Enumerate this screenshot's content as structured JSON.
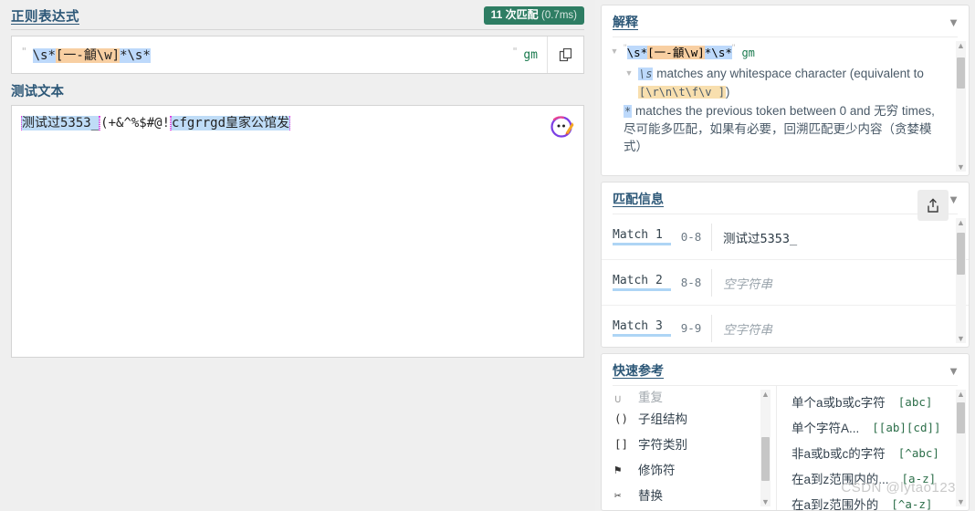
{
  "left": {
    "regex_section_title": "正则表达式",
    "match_badge": {
      "count": "11 次匹配",
      "time": "(0.7ms)"
    },
    "regex": {
      "quote": "\"",
      "tokens": [
        {
          "text": "\\s*",
          "style": "blue"
        },
        {
          "text": "[一-龥\\w]",
          "style": "orange"
        },
        {
          "text": "*",
          "style": "blue"
        },
        {
          "text": "\\s*",
          "style": "blue"
        }
      ],
      "full": "\\s*[一-龥\\w]*\\s*",
      "flags": "gm",
      "copy_icon": "copy-icon"
    },
    "test_section_title": "测试文本",
    "test_text": {
      "seg1": "测试过5353_",
      "seg2": "(+&^%$#@!",
      "seg3": "cfgrrgd皇家公馆发",
      "full": "测试过5353_(+&^%$#@!cfgrrgd皇家公馆发"
    },
    "mascot_icon": "mascot-avatar-icon"
  },
  "right": {
    "explain": {
      "title": "解释",
      "chevron": "chevron-down-icon",
      "regex_quote": "\"",
      "regex_tokens": [
        {
          "text": "\\s*",
          "style": "blue"
        },
        {
          "text": "[一-龥\\w]",
          "style": "orange"
        },
        {
          "text": "*",
          "style": "blue"
        },
        {
          "text": "\\s*",
          "style": "blue"
        }
      ],
      "flags": "gm",
      "line1_code": "\\s",
      "line1_text": " matches any whitespace character (equivalent to ",
      "line1_code2": "[\\r\\n\\t\\f\\v ]",
      "line1_tail": ")",
      "line2_code": "*",
      "line2_text": " matches the previous token between 0 and 无穷 times, 尽可能多匹配，如果有必要，回溯匹配更少内容（贪婪模式）"
    },
    "match_info": {
      "title": "匹配信息",
      "chevron": "chevron-down-icon",
      "share_icon": "share-export-icon",
      "rows": [
        {
          "name": "Match 1",
          "range": "0-8",
          "value": "测试过5353_",
          "empty": false
        },
        {
          "name": "Match 2",
          "range": "8-8",
          "value": "空字符串",
          "empty": true
        },
        {
          "name": "Match 3",
          "range": "9-9",
          "value": "空字符串",
          "empty": true
        }
      ]
    },
    "quick_ref": {
      "title": "快速参考",
      "chevron": "chevron-down-icon",
      "left_items": [
        {
          "icon": "∪",
          "label": "重复",
          "partial": true
        },
        {
          "icon": "()",
          "label": "子组结构",
          "partial": false
        },
        {
          "icon": "[]",
          "label": "字符类别",
          "partial": false
        },
        {
          "icon": "⚑",
          "label": "修饰符",
          "partial": false
        },
        {
          "icon": "✂",
          "label": "替换",
          "partial": false
        }
      ],
      "right_items": [
        {
          "desc": "单个a或b或c字符",
          "code": "[abc]"
        },
        {
          "desc": "单个字符A...",
          "code": "[[ab][cd]]"
        },
        {
          "desc": "非a或b或c的字符",
          "code": "[^abc]"
        },
        {
          "desc": "在a到z范围内的...",
          "code": "[a-z]"
        },
        {
          "desc": "在a到z范围外的",
          "code": "[^a-z]"
        }
      ]
    },
    "watermark": "CSDN @lytao123"
  }
}
